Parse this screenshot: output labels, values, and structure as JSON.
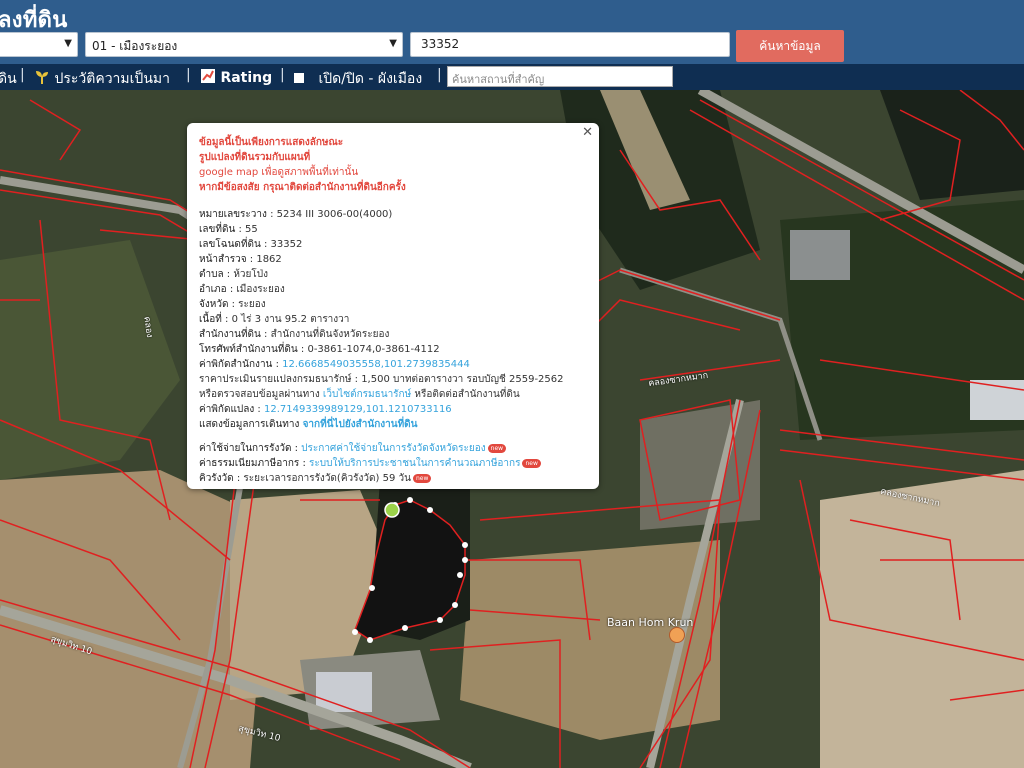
{
  "header": {
    "title": "ลงที่ดิน",
    "province_select": "",
    "district_select": "01 - เมืองระยอง",
    "parcel_input": "33352",
    "search_button": "ค้นหาข้อมูล"
  },
  "toolbar": {
    "item_0": "ดิน",
    "history": "ประวัติความเป็นมา",
    "rating": "Rating",
    "layer_toggle": "เปิด/ปิด - ผังเมือง",
    "landmark_placeholder": "ค้นหาสถานที่สำคัญ"
  },
  "popup": {
    "warning_1": "ข้อมูลนี้เป็นเพียงการแสดงลักษณะ",
    "warning_2": "รูปแปลงที่ดินรวมกับแผนที่",
    "warning_3": "google map เพื่อดูสภาพพื้นที่เท่านั้น",
    "warning_4": "หากมีข้อสงสัย กรุณาติดต่อสำนักงานที่ดินอีกครั้ง",
    "map_sheet_label": "หมายเลขระวาง",
    "map_sheet_value": " : 5234 III 3006-00(4000)",
    "land_no_label": "เลขที่ดิน",
    "land_no_value": " : 55",
    "deed_no_label": "เลขโฉนดที่ดิน",
    "deed_no_value": " : 33352",
    "survey_page_label": "หน้าสำรวจ",
    "survey_page_value": " : 1862",
    "subdistrict_label": "ตำบล",
    "subdistrict_value": " : ห้วยโป่ง",
    "district_label": "อำเภอ",
    "district_value": " : เมืองระยอง",
    "province_label": "จังหวัด",
    "province_value": " : ระยอง",
    "area_label": "เนื้อที่",
    "area_value": " : 0 ไร่ 3 งาน 95.2 ตารางวา",
    "office_label": "สำนักงานที่ดิน",
    "office_value": " : สำนักงานที่ดินจังหวัดระยอง",
    "phone_label": "โทรศัพท์สำนักงานที่ดิน",
    "phone_value": " : 0-3861-1074,0-3861-4112",
    "office_coord_label": "ค่าพิกัดสำนักงาน",
    "office_coord_value": "12.6668549035558,101.2739835444",
    "price_text": "ราคาประเมินรายแปลงกรมธนารักษ์ : 1,500 บาทต่อตารางวา รอบบัญชี 2559-2562",
    "check_prefix": "หรือตรวจสอบข้อมูลผ่านทาง",
    "check_link": "เว็บไซต์กรมธนารักษ์",
    "check_suffix": "หรือติดต่อสำนักงานที่ดิน",
    "parcel_coord_label": "ค่าพิกัดแปลง",
    "parcel_coord_value": "12.7149339989129,101.1210733116",
    "route_prefix": "แสดงข้อมูลการเดินทาง",
    "route_link": "จากที่นี่ไปยังสำนักงานที่ดิน",
    "fee_label": "ค่าใช้จ่ายในการรังวัด :",
    "fee_link": "ประกาศค่าใช้จ่ายในการรังวัดจังหวัดระยอง",
    "tax_label": "ค่าธรรมเนียมภาษีอากร :",
    "tax_link": "ระบบให้บริการประชาชนในการคำนวณภาษีอากร",
    "queue_label": "คิวรังวัด",
    "queue_value": " : ระยะเวลารอการรังวัด(คิวรังวัด)",
    "queue_days": "59 วัน",
    "new_badge": "new"
  },
  "map": {
    "place_name": "Baan Hom Krun",
    "road_label_1": "คลองซากหมาก",
    "road_label_2": "คลองซากหมาก",
    "road_label_3": "สุขุมวิท 10",
    "road_label_4": "สุขุมวิท 10",
    "road_label_5": "คลอง"
  },
  "colors": {
    "header_bg": "#2f5d8d",
    "toolbar_bg": "#0f2e52",
    "search_btn": "#e16b5f",
    "parcel_lines": "#e02020"
  }
}
